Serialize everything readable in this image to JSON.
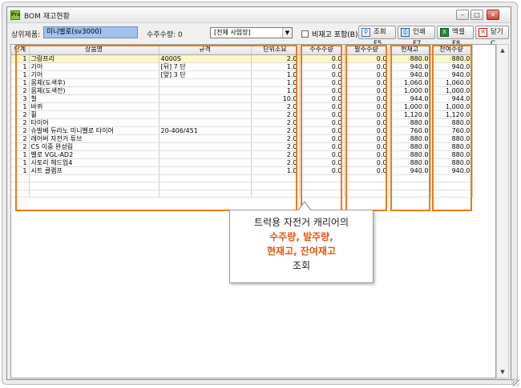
{
  "window": {
    "title": "BOM 재고현황",
    "app_icon": "Pro"
  },
  "toolbar": {
    "product_label": "상위제품:",
    "product_value": "미니벨로(sv3000)",
    "order_qty_label": "수주수량: 0",
    "business_select": "[전체 사업장]",
    "include_nonstock_label": "비재고 포함(B)",
    "search_button": "조회 F5",
    "print_button": "인쇄 F7",
    "excel_button": "엑셀 F8",
    "close_button": "닫기 C"
  },
  "table": {
    "columns": [
      "단계",
      "상품명",
      "규격",
      "단위소요",
      "수주수량",
      "발주수량",
      "현재고",
      "잔여수량"
    ],
    "rows": [
      [
        "1",
        "그랑프리",
        "4000S",
        "2.0",
        "0.0",
        "0.0",
        "880.0",
        "880.0"
      ],
      [
        "1",
        "기어",
        "[뒤] 7 단",
        "1.0",
        "0.0",
        "0.0",
        "940.0",
        "940.0"
      ],
      [
        "1",
        "기어",
        "[앞] 3 단",
        "1.0",
        "0.0",
        "0.0",
        "940.0",
        "940.0"
      ],
      [
        "1",
        "몸체(도색후)",
        "",
        "1.0",
        "0.0",
        "0.0",
        "1,060.0",
        "1,060.0"
      ],
      [
        "2",
        "몸체(도색전)",
        "",
        "1.0",
        "0.0",
        "0.0",
        "1,000.0",
        "1,000.0"
      ],
      [
        "3",
        "철",
        "",
        "10.0",
        "0.0",
        "0.0",
        "944.0",
        "944.0"
      ],
      [
        "1",
        "바퀴",
        "",
        "2.0",
        "0.0",
        "0.0",
        "1,000.0",
        "1,000.0"
      ],
      [
        "2",
        "휠",
        "",
        "2.0",
        "0.0",
        "0.0",
        "1,120.0",
        "1,120.0"
      ],
      [
        "2",
        "타이어",
        "",
        "2.0",
        "0.0",
        "0.0",
        "880.0",
        "880.0"
      ],
      [
        "2",
        "슈발베 듀라노 미니벨로 타이어",
        "20-406/451",
        "2.0",
        "0.0",
        "0.0",
        "760.0",
        "760.0"
      ],
      [
        "2",
        "레어버 자전거 튜브",
        "",
        "2.0",
        "0.0",
        "0.0",
        "880.0",
        "880.0"
      ],
      [
        "2",
        "CS 이중 완성림",
        "",
        "2.0",
        "0.0",
        "0.0",
        "880.0",
        "880.0"
      ],
      [
        "1",
        "벨로 VGL-AD2",
        "",
        "2.0",
        "0.0",
        "0.0",
        "880.0",
        "880.0"
      ],
      [
        "1",
        "사토리 헤드업4",
        "",
        "2.0",
        "0.0",
        "0.0",
        "880.0",
        "880.0"
      ],
      [
        "1",
        "시트 클램프",
        "",
        "1.0",
        "0.0",
        "0.0",
        "940.0",
        "940.0"
      ]
    ]
  },
  "callout": {
    "line1": "트럭용 자전거 캐리어의",
    "line2": "수주량, 발주량,",
    "line3": "현재고, 잔여재고",
    "line4": "조회"
  },
  "colors": {
    "highlight": "#ef7a14",
    "callout_accent": "#e8550c",
    "selected_row": "#fff6c6",
    "input_bg": "#9fc3ee"
  }
}
